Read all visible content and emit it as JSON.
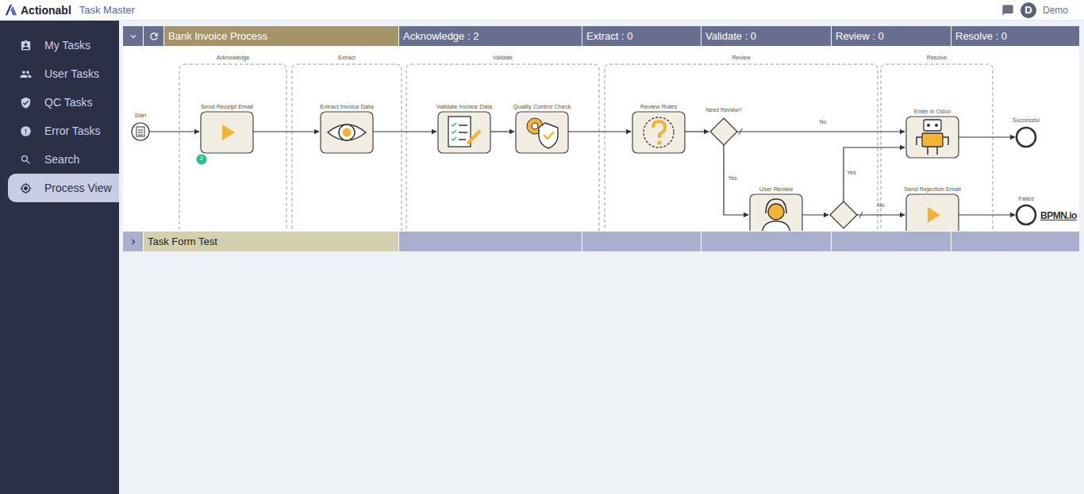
{
  "app": {
    "brand": "Actionabl",
    "product": "Task Master",
    "user_initial": "D",
    "user_name": "Demo"
  },
  "sidebar": {
    "items": [
      {
        "label": "My Tasks",
        "selected": false
      },
      {
        "label": "User Tasks",
        "selected": false
      },
      {
        "label": "QC Tasks",
        "selected": false
      },
      {
        "label": "Error Tasks",
        "selected": false
      },
      {
        "label": "Search",
        "selected": false
      },
      {
        "label": "Process View",
        "selected": true
      }
    ]
  },
  "processes": [
    {
      "name": "Bank Invoice Process",
      "expanded": true,
      "stages": [
        {
          "label": "Acknowledge : 2"
        },
        {
          "label": "Extract : 0"
        },
        {
          "label": "Validate : 0"
        },
        {
          "label": "Review : 0"
        },
        {
          "label": "Resolve : 0"
        }
      ],
      "diagram": {
        "lanes": [
          {
            "label": "Acknowledge"
          },
          {
            "label": "Extract"
          },
          {
            "label": "Validate"
          },
          {
            "label": "Review"
          },
          {
            "label": "Resolve"
          }
        ],
        "events": [
          {
            "label": "Start",
            "kind": "start"
          },
          {
            "label": "Successful",
            "kind": "end"
          },
          {
            "label": "Failed",
            "kind": "end"
          }
        ],
        "tasks": [
          {
            "label": "Send Receipt Email",
            "kind": "play",
            "badge": "2"
          },
          {
            "label": "Extract Invoice Data",
            "kind": "eye",
            "badge": ""
          },
          {
            "label": "Validate Invoice Data",
            "kind": "checklist",
            "badge": ""
          },
          {
            "label": "Quality Control Check",
            "kind": "shield",
            "badge": ""
          },
          {
            "label": "Review Rules",
            "kind": "question",
            "badge": ""
          },
          {
            "label": "Enter in Odoo",
            "kind": "robot",
            "badge": ""
          },
          {
            "label": "User Review",
            "kind": "person",
            "badge": ""
          },
          {
            "label": "Send Rejection Email",
            "kind": "play",
            "badge": ""
          }
        ],
        "gateways": [
          {
            "label": "Need Review?"
          },
          {
            "label": ""
          }
        ],
        "flows": [
          {
            "label": "No"
          },
          {
            "label": "Yes"
          },
          {
            "label": "Yes"
          },
          {
            "label": "No"
          }
        ],
        "watermark": "BPMN.io"
      }
    },
    {
      "name": "Task Form Test",
      "expanded": false,
      "stages": []
    }
  ]
}
